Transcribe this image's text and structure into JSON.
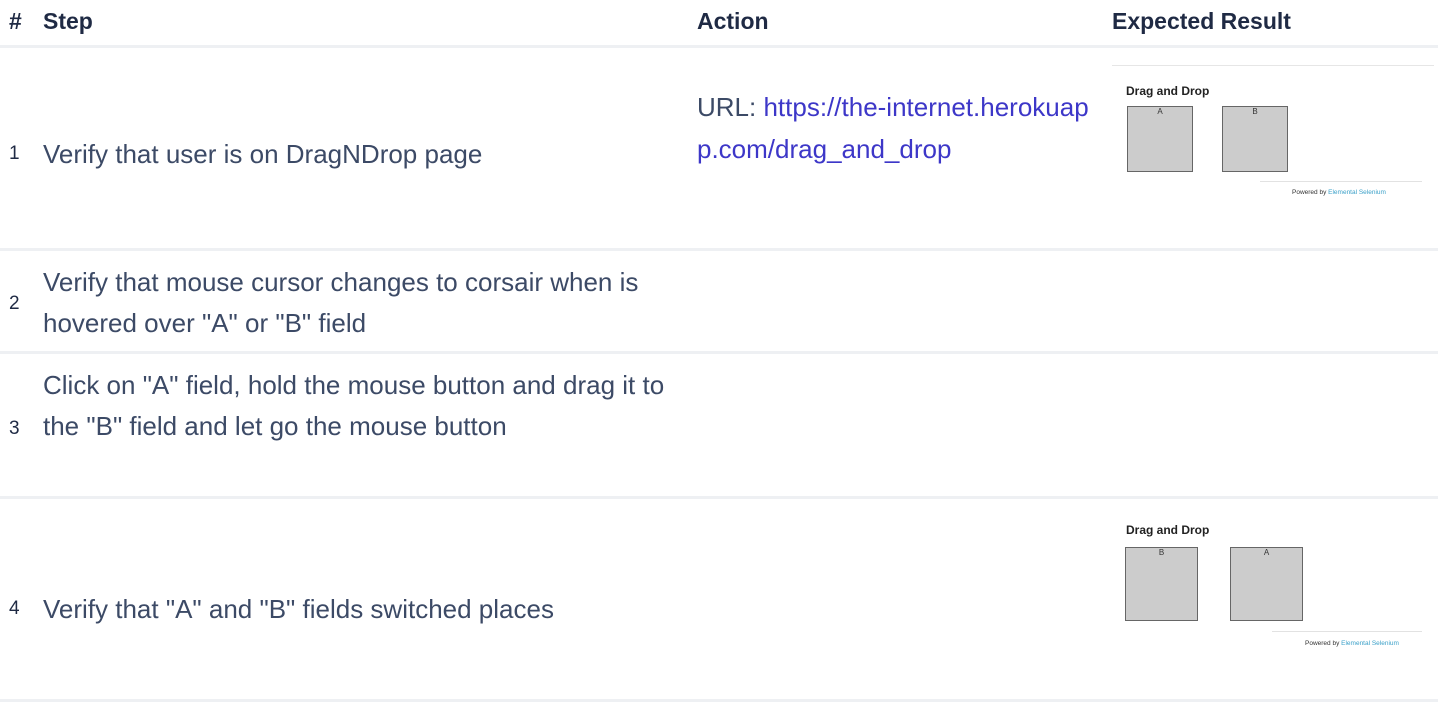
{
  "headers": {
    "num": "#",
    "step": "Step",
    "action": "Action",
    "expected": "Expected Result"
  },
  "rows": [
    {
      "num": "1",
      "step": "Verify that user is on DragNDrop page",
      "action_prefix": "URL: ",
      "action_link": "https://the-internet.herokuapp.com/drag_and_drop",
      "expected": {
        "title": "Drag and Drop",
        "box_left": "A",
        "box_right": "B",
        "powered_prefix": "Powered by ",
        "powered_link": "Elemental Selenium"
      }
    },
    {
      "num": "2",
      "step": "Verify that mouse cursor changes to corsair when is hovered over \"A\" or \"B\" field"
    },
    {
      "num": "3",
      "step": "Click on \"A\" field, hold the mouse button and drag it to the \"B\" field and let go the mouse button"
    },
    {
      "num": "4",
      "step": "Verify that \"A\" and \"B\" fields switched places",
      "expected": {
        "title": "Drag and Drop",
        "box_left": "B",
        "box_right": "A",
        "powered_prefix": "Powered by ",
        "powered_link": "Elemental Selenium"
      }
    }
  ],
  "colors": {
    "link": "#3d37c8",
    "text": "#3c4a66",
    "header": "#1f2a44",
    "divider": "#eef0f3"
  }
}
